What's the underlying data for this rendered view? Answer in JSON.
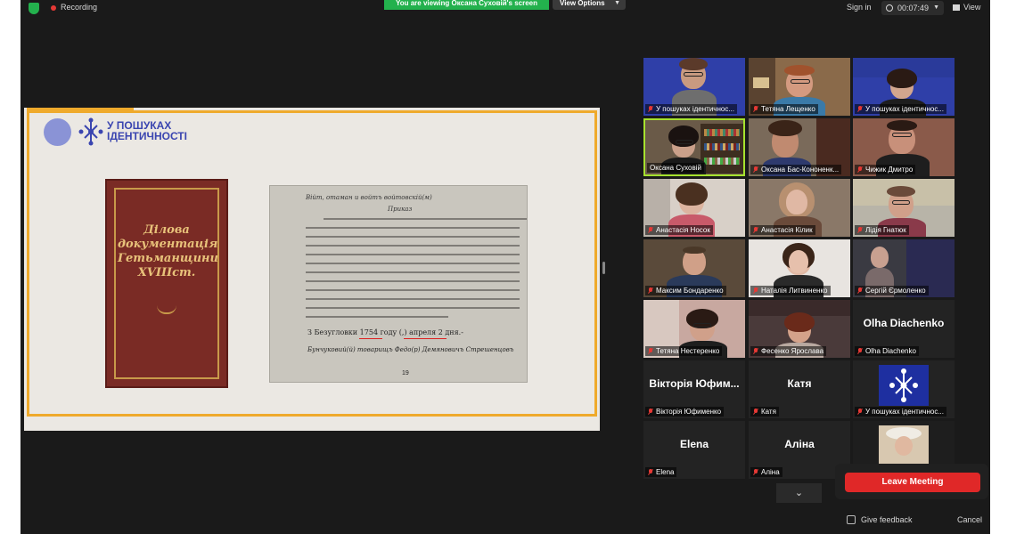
{
  "topbar": {
    "recording_label": "Recording",
    "viewing_banner": "You are viewing Оксана Суховій's screen",
    "view_options_label": "View Options",
    "sign_in_label": "Sign in",
    "timer_value": "00:07:49",
    "view_label": "View",
    "colors": {
      "banner": "#23b14d",
      "recording_dot": "#e53935"
    }
  },
  "shared_screen": {
    "logo_text_line1": "У ПОШУКАХ",
    "logo_text_line2": "ІДЕНТИЧНОСТІ",
    "book_title_line1": "Ділова",
    "book_title_line2": "документація",
    "book_title_line3": "Гетьманщини",
    "book_title_line4": "XVIIIст.",
    "scan_header": "Війт, отаман и войтъ войтовскій(м)",
    "scan_subheader": "Приказ",
    "scan_date": "З Безугловки 1754 году (,) апреля 2 дня.-",
    "scan_signature": "Бунчуковий(й) товарищъ Федо(р) Демяновичъ Стрешенцовъ",
    "scan_page": "19",
    "accent_color": "#efaa2c"
  },
  "participants": [
    {
      "name": "У пошуках ідентичнос...",
      "muted": true
    },
    {
      "name": "Тетяна Лещенко",
      "muted": true
    },
    {
      "name": "У пошуках ідентичнос...",
      "muted": true
    },
    {
      "name": "Оксана Суховій",
      "muted": false,
      "active_speaker": true
    },
    {
      "name": "Оксана Бас-Кононенк...",
      "muted": true
    },
    {
      "name": "Чижик Дмитро",
      "muted": true
    },
    {
      "name": "Анастасія Носок",
      "muted": true
    },
    {
      "name": "Анастасія Кілик",
      "muted": true
    },
    {
      "name": "Лідія Гнатюк",
      "muted": true
    },
    {
      "name": "Максим Бондаренко",
      "muted": true
    },
    {
      "name": "Наталія Литвиненко",
      "muted": true
    },
    {
      "name": "Сергій Єрмоленко",
      "muted": true
    },
    {
      "name": "Тетяна Нестеренко",
      "muted": true
    },
    {
      "name": "Фесенко Ярослава",
      "muted": true
    },
    {
      "name": "Olha Diachenko",
      "muted": true,
      "display_name": "Olha Diachenko"
    },
    {
      "name": "Вікторія Юфименко",
      "muted": true,
      "display_name": "Вікторія Юфим..."
    },
    {
      "name": "Катя",
      "muted": true,
      "display_name": "Катя"
    },
    {
      "name": "У пошуках ідентичнос...",
      "muted": true
    },
    {
      "name": "Elena",
      "muted": true,
      "display_name": "Elena"
    },
    {
      "name": "Аліна",
      "muted": true,
      "display_name": "Аліна"
    }
  ],
  "controls": {
    "leave_label": "Leave Meeting",
    "feedback_label": "Give feedback",
    "cancel_label": "Cancel",
    "scroll_down_icon": "chevron-down-icon",
    "leave_color": "#e02828"
  }
}
